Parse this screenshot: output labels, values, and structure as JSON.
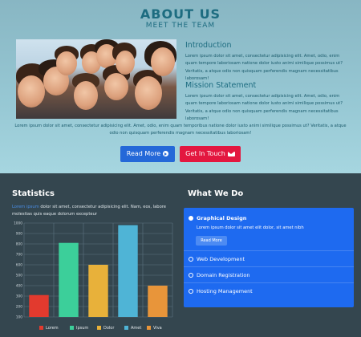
{
  "about": {
    "title": "ABOUT US",
    "subtitle": "MEET THE TEAM",
    "intro_heading": "Introduction",
    "intro_text": "Lorem ipsum dolor sit amet, consectetur adipisicing elit. Amet, odio, enim quam tempore laboriosam natione dolor iusto animi similique possimus ut? Veritatis, a atque odio non quisquam perferendis magnam necessitatibus laborosam!",
    "mission_heading": "Mission Statement",
    "mission_text": "Lorem ipsum dolor sit amet, consectetur adipisicing elit. Amet, odio, enim quam tempore laboriosam natione dolor iusto animi similique possimus ut? Veritatis, a atque odio non quisquam perferendis magnam necessitatibus laborosam!",
    "wide_text": "Lorem ipsum dolor sit amet, consectetur adipisicing elit. Amet, odio, enim quam temporibus natione dolor iusto animi similique possimus ut? Veritatis, a atque odio non quisquam perferendis magnam necessitatibus laboriosam!",
    "read_more": "Read More",
    "get_in_touch": "Get In Touch"
  },
  "stats": {
    "heading": "Statistics",
    "text_highlight": "Lorem ipsum",
    "text": "dolor sit amet, consectetur adipisicing elit. Nam, eos, labore molestias quis eaque dolorum excepteur"
  },
  "chart_data": {
    "type": "bar",
    "categories": [
      "Lorem",
      "Ipsum",
      "Dolor",
      "Amet",
      "Viva"
    ],
    "values": [
      310,
      810,
      600,
      980,
      400
    ],
    "colors": [
      "#e23a2e",
      "#3ccf9a",
      "#e8b13a",
      "#4fb4d6",
      "#e8953a"
    ],
    "ylim": [
      100,
      1000
    ],
    "yticks": [
      "100",
      "200",
      "300",
      "400",
      "500",
      "600",
      "700",
      "800",
      "900",
      "1000"
    ],
    "grid": true,
    "legend": "bottom"
  },
  "whatwedo": {
    "heading": "What We Do",
    "items": [
      {
        "label": "Graphical Design",
        "body": "Lorem ipsum dolor sit amet elit dolor, sit amet nibh",
        "button": "Read More",
        "open": true
      },
      {
        "label": "Web Development",
        "open": false
      },
      {
        "label": "Domain Registration",
        "open": false
      },
      {
        "label": "Hosting Management",
        "open": false
      }
    ]
  }
}
